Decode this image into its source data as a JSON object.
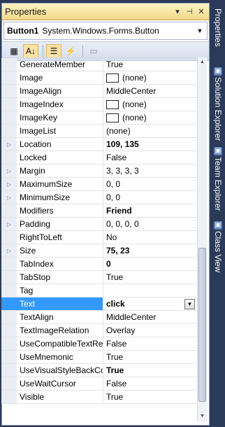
{
  "panel": {
    "title": "Properties",
    "pin_glyph": "▾",
    "autohide_glyph": "⊣",
    "close_glyph": "✕"
  },
  "object_selector": {
    "name": "Button1",
    "type": "System.Windows.Forms.Button"
  },
  "toolbar": {
    "buttons": [
      {
        "name": "categorized-button",
        "glyph": "▦"
      },
      {
        "name": "alphabetical-button",
        "glyph": "A↓"
      },
      {
        "name": "properties-button",
        "glyph": "☰"
      },
      {
        "name": "events-button",
        "glyph": "⚡"
      },
      {
        "name": "property-pages-button",
        "glyph": "▭"
      }
    ]
  },
  "properties": [
    {
      "name": "GenerateMember",
      "value": "True"
    },
    {
      "name": "Image",
      "value": "(none)",
      "swatch": true
    },
    {
      "name": "ImageAlign",
      "value": "MiddleCenter"
    },
    {
      "name": "ImageIndex",
      "value": "(none)",
      "swatch": true
    },
    {
      "name": "ImageKey",
      "value": "(none)",
      "swatch": true
    },
    {
      "name": "ImageList",
      "value": "(none)"
    },
    {
      "name": "Location",
      "value": "109, 135",
      "bold": true,
      "expandable": true
    },
    {
      "name": "Locked",
      "value": "False"
    },
    {
      "name": "Margin",
      "value": "3, 3, 3, 3",
      "expandable": true
    },
    {
      "name": "MaximumSize",
      "value": "0, 0",
      "expandable": true
    },
    {
      "name": "MinimumSize",
      "value": "0, 0",
      "expandable": true
    },
    {
      "name": "Modifiers",
      "value": "Friend",
      "bold": true
    },
    {
      "name": "Padding",
      "value": "0, 0, 0, 0",
      "expandable": true
    },
    {
      "name": "RightToLeft",
      "value": "No"
    },
    {
      "name": "Size",
      "value": "75, 23",
      "bold": true,
      "expandable": true
    },
    {
      "name": "TabIndex",
      "value": "0",
      "bold": true
    },
    {
      "name": "TabStop",
      "value": "True"
    },
    {
      "name": "Tag",
      "value": ""
    },
    {
      "name": "Text",
      "value": "click",
      "bold": true,
      "selected": true,
      "dropdown": true
    },
    {
      "name": "TextAlign",
      "value": "MiddleCenter"
    },
    {
      "name": "TextImageRelation",
      "value": "Overlay"
    },
    {
      "name": "UseCompatibleTextRer",
      "value": "False"
    },
    {
      "name": "UseMnemonic",
      "value": "True"
    },
    {
      "name": "UseVisualStyleBackCol",
      "value": "True",
      "bold": true
    },
    {
      "name": "UseWaitCursor",
      "value": "False"
    },
    {
      "name": "Visible",
      "value": "True"
    }
  ],
  "side_tabs": [
    {
      "label": "Properties",
      "icon": "properties-icon"
    },
    {
      "label": "Solution Explorer",
      "icon": "solution-explorer-icon"
    },
    {
      "label": "Team Explorer",
      "icon": "team-explorer-icon"
    },
    {
      "label": "Class View",
      "icon": "class-view-icon"
    }
  ],
  "colors": {
    "selection": "#3399ff",
    "title_bar": "#f4d88a",
    "background": "#2b3a58"
  }
}
